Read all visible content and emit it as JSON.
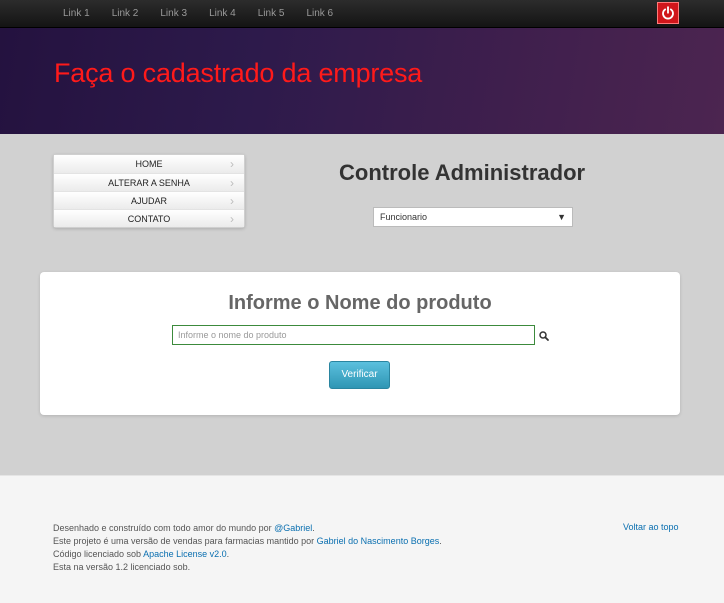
{
  "navbar": {
    "links": [
      "Link 1",
      "Link 2",
      "Link 3",
      "Link 4",
      "Link 5",
      "Link 6"
    ],
    "power_icon": "power-icon",
    "power_color": "#d0161b"
  },
  "hero": {
    "title": "Faça o cadastrado da empresa",
    "title_color": "#ff1a1a"
  },
  "sidebar": {
    "items": [
      {
        "label": "HOME"
      },
      {
        "label": "ALTERAR A SENHA"
      },
      {
        "label": "AJUDAR"
      },
      {
        "label": "CONTATO"
      }
    ],
    "item_icon": "chevron-right-icon"
  },
  "admin": {
    "title": "Controle Administrador",
    "role_select_value": "Funcionario"
  },
  "search": {
    "heading": "Informe o Nome do produto",
    "placeholder": "Informe o nome do produto",
    "icon": "search-icon",
    "button_label": "Verificar"
  },
  "footer": {
    "line1_prefix": "Desenhado e construído com todo amor do mundo por ",
    "line1_link": "@Gabriel",
    "line1_suffix": ".",
    "line2_prefix": "Este projeto é uma versão de vendas para farmacias mantido por ",
    "line2_link": "Gabriel do Nascimento Borges",
    "line2_suffix": ".",
    "line3_prefix": "Código licenciado sob ",
    "line3_link": "Apache License v2.0",
    "line3_suffix": ".",
    "line4": "Esta na versão 1.2 licenciado sob.",
    "back_to_top": "Voltar ao topo",
    "link_color": "#0a6fb0"
  }
}
